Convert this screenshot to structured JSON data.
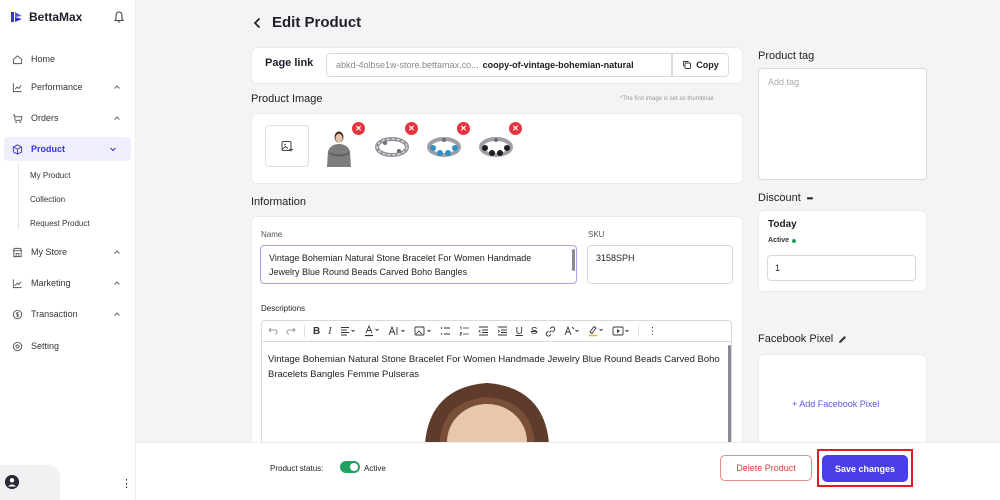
{
  "sidebar": {
    "brand": "BettaMax",
    "items": [
      {
        "label": "Home"
      },
      {
        "label": "Performance"
      },
      {
        "label": "Orders"
      },
      {
        "label": "Product"
      },
      {
        "label": "My Store"
      },
      {
        "label": "Marketing"
      },
      {
        "label": "Transaction"
      },
      {
        "label": "Setting"
      }
    ],
    "sub_items": [
      {
        "label": "My Product"
      },
      {
        "label": "Collection"
      },
      {
        "label": "Request Product"
      }
    ]
  },
  "page": {
    "title": "Edit Product"
  },
  "page_link": {
    "label": "Page link",
    "prefix": "abkd-4olbse1w-store.bettamax.co...",
    "slug": "coopy-of-vintage-bohemian-natural",
    "copy_label": "Copy"
  },
  "product_image": {
    "label": "Product Image",
    "note": "*The first image is set as thumbnail."
  },
  "information": {
    "label": "Information",
    "name_label": "Name",
    "name_value": "Vintage Bohemian Natural Stone Bracelet For Women Handmade Jewelry Blue Round Beads Carved Boho Bangles",
    "sku_label": "SKU",
    "sku_value": "3158SPH",
    "descriptions_label": "Descriptions",
    "description_text": "Vintage Bohemian Natural Stone Bracelet For Women Handmade Jewelry Blue Round Beads Carved Boho Bracelets Bangles Femme Pulseras"
  },
  "product_tag": {
    "label": "Product tag",
    "placeholder": "Add tag"
  },
  "discount": {
    "label": "Discount",
    "more": "•••",
    "period": "Today",
    "status": "Active",
    "value": "1"
  },
  "facebook_pixel": {
    "label": "Facebook Pixel",
    "add_label": "+ Add Facebook Pixel"
  },
  "footer": {
    "status_label": "Product status:",
    "status_value": "Active",
    "delete_label": "Delete Product",
    "save_label": "Save changes"
  },
  "colors": {
    "accent": "#4b3ee6",
    "danger": "#e8343f",
    "active_green": "#22a060"
  }
}
